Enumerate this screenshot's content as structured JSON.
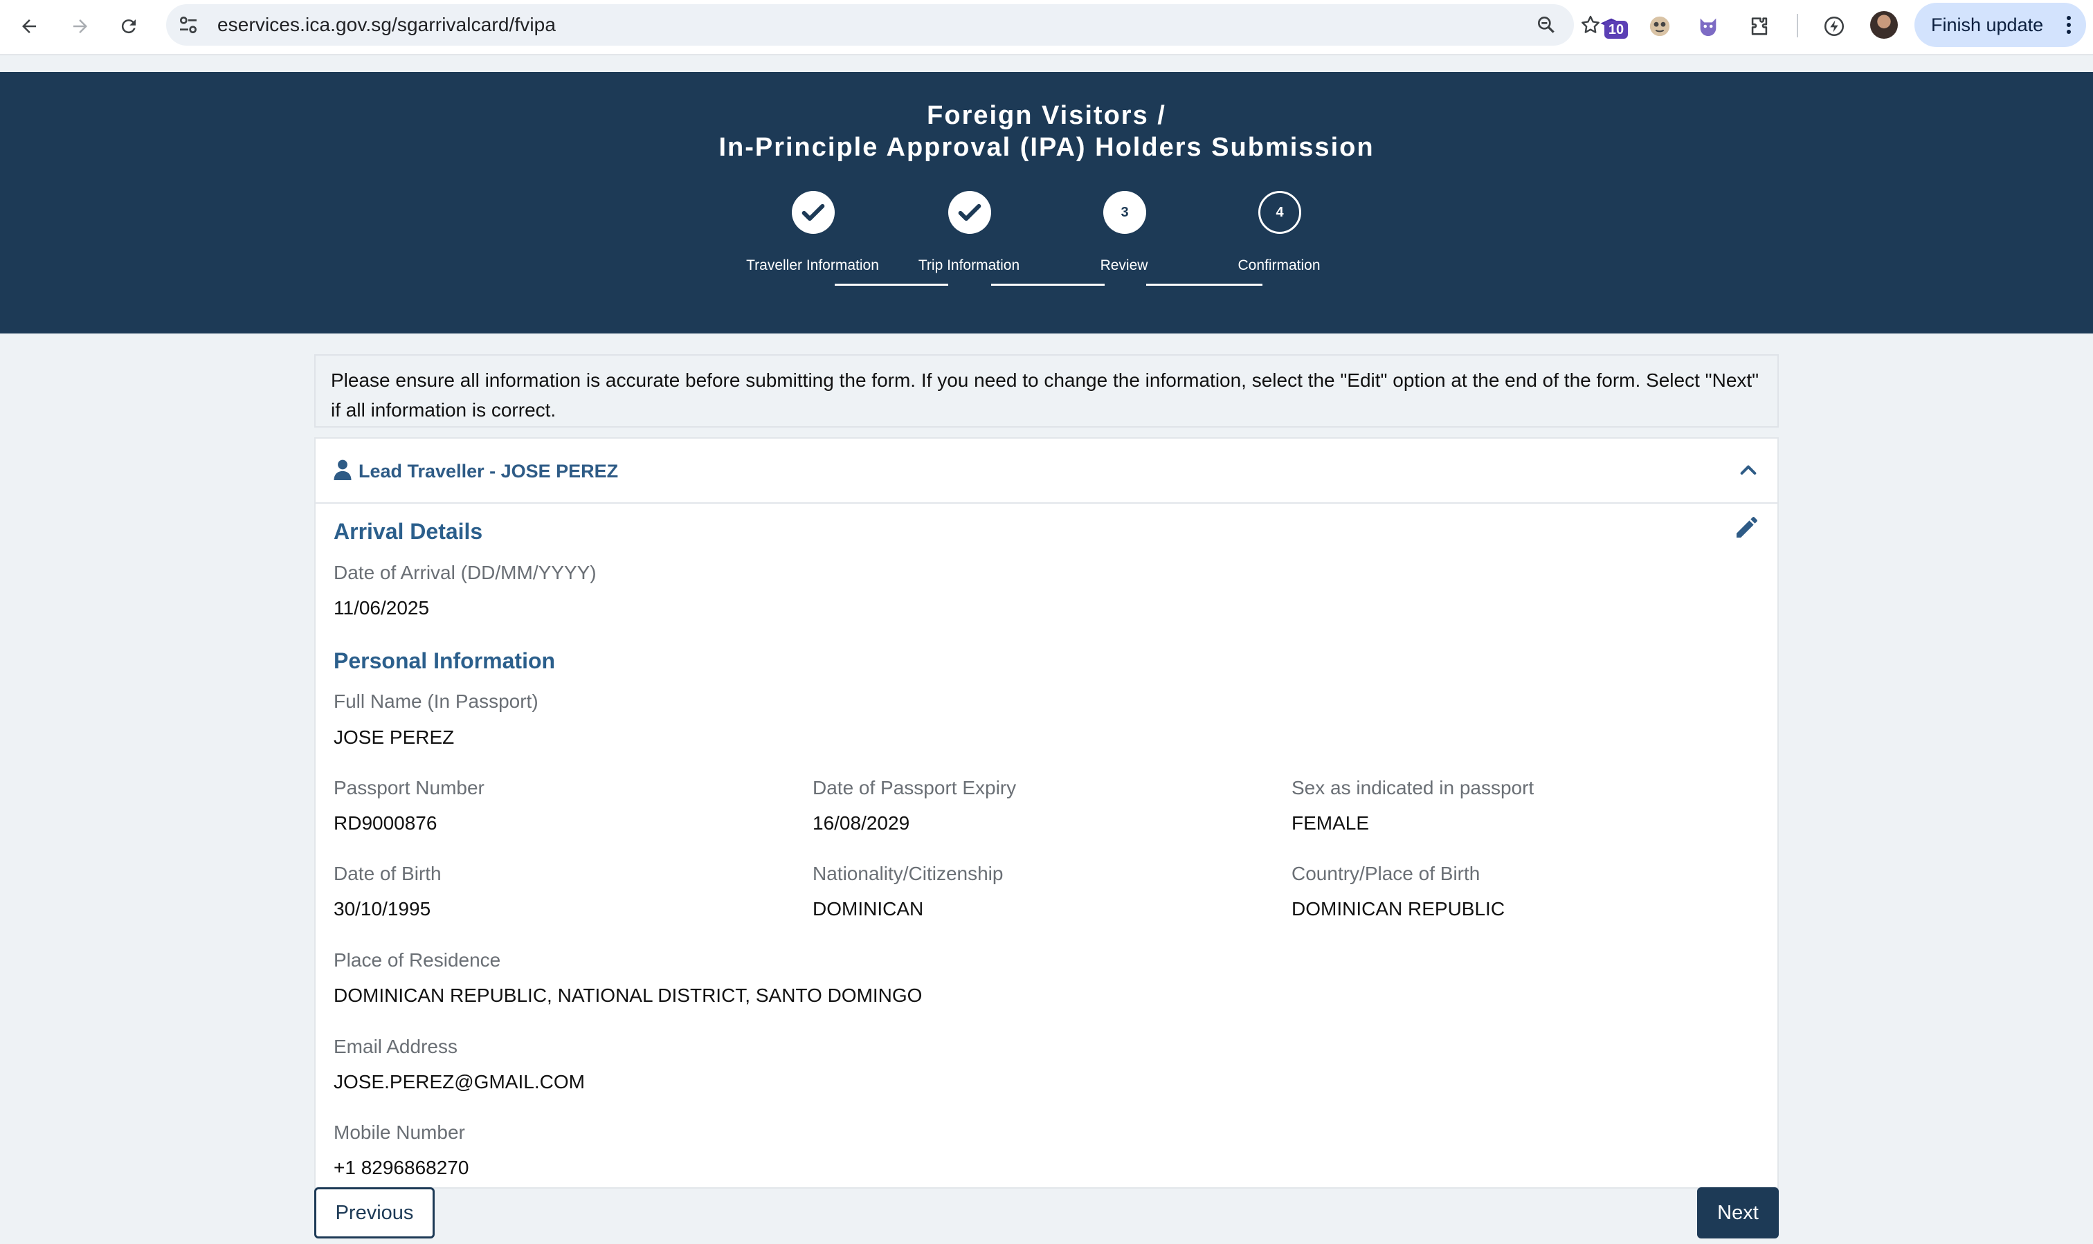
{
  "browser": {
    "url": "eservices.ica.gov.sg/sgarrivalcard/fvipa",
    "extension_badge": "10",
    "finish_update_label": "Finish update"
  },
  "header": {
    "title_line1": "Foreign Visitors /",
    "title_line2": "In-Principle Approval (IPA) Holders Submission",
    "steps": [
      {
        "label": "Traveller Information",
        "state": "done",
        "number": "1"
      },
      {
        "label": "Trip Information",
        "state": "done",
        "number": "2"
      },
      {
        "label": "Review",
        "state": "current",
        "number": "3"
      },
      {
        "label": "Confirmation",
        "state": "pending",
        "number": "4"
      }
    ]
  },
  "notice": "Please ensure all information is accurate before submitting the form. If you need to change the information, select the \"Edit\" option at the end of the form. Select \"Next\" if all information is correct.",
  "traveller": {
    "header": "Lead Traveller - JOSE PEREZ",
    "arrival_title": "Arrival Details",
    "date_of_arrival_label": "Date of Arrival (DD/MM/YYYY)",
    "date_of_arrival": "11/06/2025",
    "personal_title": "Personal Information",
    "full_name_label": "Full Name (In Passport)",
    "full_name": "JOSE PEREZ",
    "passport_number_label": "Passport Number",
    "passport_number": "RD9000876",
    "passport_expiry_label": "Date of Passport Expiry",
    "passport_expiry": "16/08/2029",
    "sex_label": "Sex as indicated in passport",
    "sex": "FEMALE",
    "dob_label": "Date of Birth",
    "dob": "30/10/1995",
    "nationality_label": "Nationality/Citizenship",
    "nationality": "DOMINICAN",
    "birth_place_label": "Country/Place of Birth",
    "birth_place": "DOMINICAN REPUBLIC",
    "residence_label": "Place of Residence",
    "residence": "DOMINICAN REPUBLIC, NATIONAL DISTRICT, SANTO DOMINGO",
    "email_label": "Email Address",
    "email": "JOSE.PEREZ@GMAIL.COM",
    "mobile_label": "Mobile Number",
    "mobile": "+1 8296868270"
  },
  "buttons": {
    "previous": "Previous",
    "next": "Next"
  },
  "colors": {
    "banner": "#1d3a56",
    "section_title": "#2b5f8c",
    "finish_update_bg": "#d3e3fd"
  }
}
